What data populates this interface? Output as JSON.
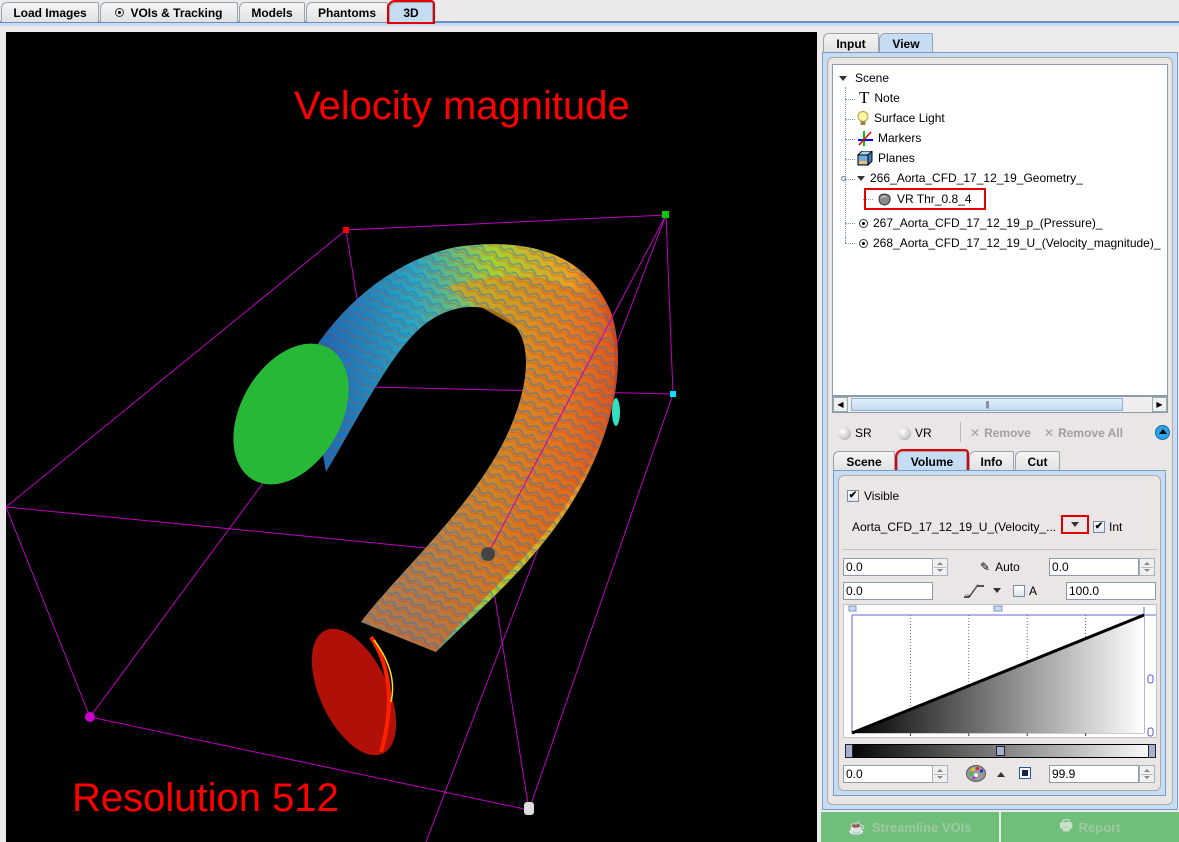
{
  "top_tabs": [
    {
      "label": "Load Images",
      "icon": null,
      "active": false
    },
    {
      "label": "VOIs & Tracking",
      "icon": "radio-dot-icon",
      "active": false
    },
    {
      "label": "Models",
      "icon": null,
      "active": false
    },
    {
      "label": "Phantoms",
      "icon": null,
      "active": false
    },
    {
      "label": "3D",
      "icon": null,
      "active": true
    }
  ],
  "viewport": {
    "annotation_top": "Velocity magnitude",
    "annotation_bottom": "Resolution 512",
    "annotation_color": "#ff0000",
    "bbox_color": "#c000c0",
    "marker_colors": {
      "red": "#ff0000",
      "green": "#00cc00",
      "cyan": "#00e0ff",
      "magenta": "#cc00cc",
      "white": "#dddddd",
      "gray": "#444444"
    }
  },
  "side_tabs": [
    {
      "label": "Input",
      "active": false
    },
    {
      "label": "View",
      "active": true
    }
  ],
  "tree": {
    "root": "Scene",
    "items": [
      {
        "label": "Note",
        "icon": "text-t-icon"
      },
      {
        "label": "Surface Light",
        "icon": "lightbulb-icon"
      },
      {
        "label": "Markers",
        "icon": "axes-markers-icon"
      },
      {
        "label": "Planes",
        "icon": "planes-cube-icon"
      },
      {
        "label": "266_Aorta_CFD_17_12_19_Geometry_",
        "icon": "expand-triangle-icon",
        "expanded": true,
        "children": [
          {
            "label": "VR Thr_0.8_4",
            "icon": "volume-render-icon",
            "highlighted": true
          }
        ]
      },
      {
        "label": "267_Aorta_CFD_17_12_19_p_(Pressure)_",
        "icon": "radio-dot-icon"
      },
      {
        "label": "268_Aorta_CFD_17_12_19_U_(Velocity_magnitude)_",
        "icon": "radio-dot-icon"
      }
    ]
  },
  "toolbar": {
    "sr_label": "SR",
    "vr_label": "VR",
    "remove_label": "Remove",
    "remove_all_label": "Remove All"
  },
  "sub_tabs": [
    {
      "label": "Scene",
      "active": false
    },
    {
      "label": "Volume",
      "active": true
    },
    {
      "label": "Info",
      "active": false
    },
    {
      "label": "Cut",
      "active": false
    }
  ],
  "volume": {
    "visible_label": "Visible",
    "visible_checked": true,
    "series_select": "Aorta_CFD_17_12_19_U_(Velocity_...",
    "int_label": "Int",
    "int_checked": true,
    "min_value": "0.0",
    "auto_label": "Auto",
    "max_value": "0.0",
    "lower_value": "0.0",
    "a_label": "A",
    "a_checked": false,
    "upper_value": "100.0",
    "transfer_curve": {
      "type": "linear",
      "x_range": [
        0,
        100
      ],
      "y_range": [
        0,
        1
      ],
      "points": [
        [
          0,
          0
        ],
        [
          100,
          1
        ]
      ]
    },
    "cmap_low": "0.0",
    "cmap_high": "99.9"
  },
  "bottom_buttons": {
    "streamline_label": "Streamline VOIs",
    "report_label": "Report"
  }
}
